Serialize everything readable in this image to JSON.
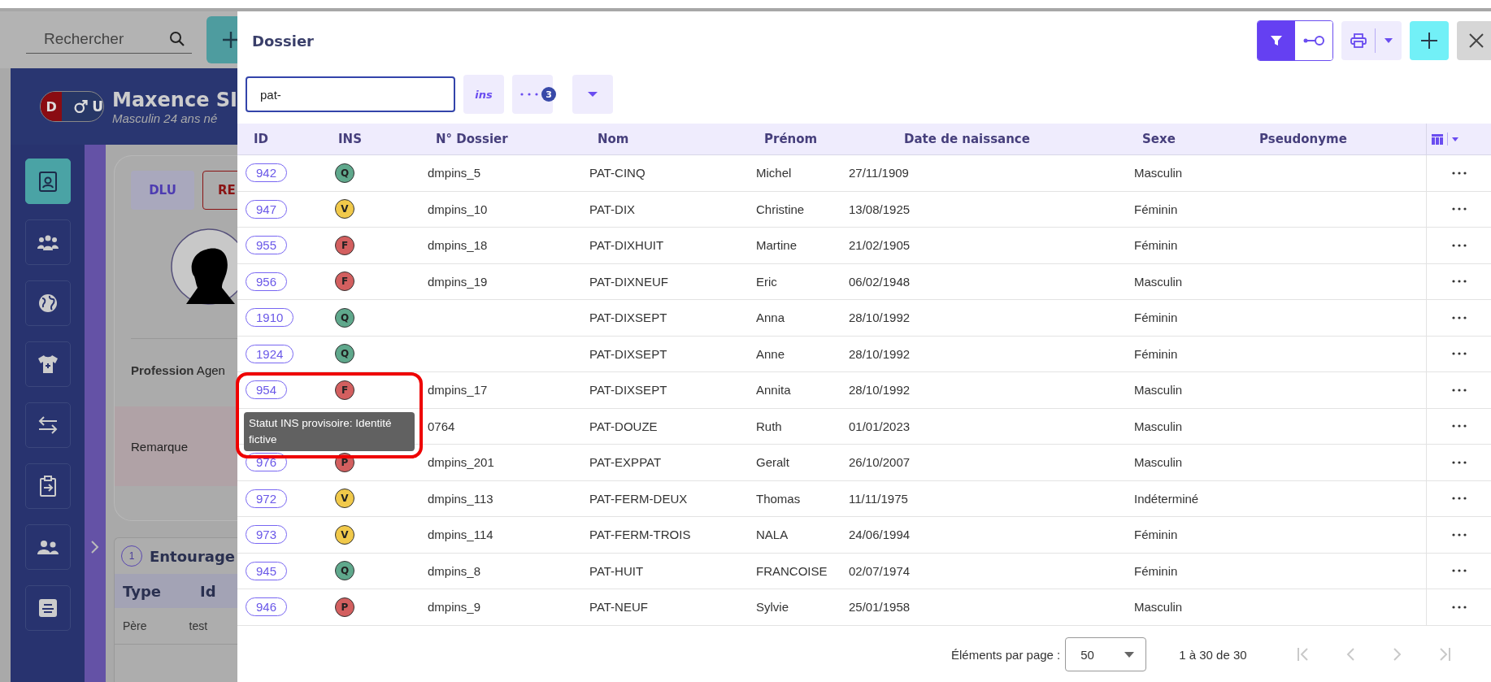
{
  "background": {
    "search_placeholder": "Rechercher",
    "patient": {
      "badge_left": "D",
      "badge_right": "U",
      "name": "Maxence SI",
      "info": "Masculin 24 ans né"
    },
    "nav": [
      {
        "kind": "id-card",
        "selected": true
      },
      {
        "kind": "group",
        "selected": false
      },
      {
        "kind": "globe",
        "selected": false
      },
      {
        "kind": "shirt",
        "selected": false
      },
      {
        "kind": "swap",
        "selected": false
      },
      {
        "kind": "clipboard",
        "selected": false
      },
      {
        "kind": "users",
        "selected": false
      },
      {
        "kind": "note",
        "selected": false
      }
    ],
    "buttons": [
      "DLU",
      "RE"
    ],
    "profession_label": "Profession",
    "profession_value": "Agen",
    "remark_label": "Remarque",
    "section": {
      "count": "1",
      "title": "Entourage",
      "columns": [
        "Type",
        "Id"
      ],
      "row": [
        "Père",
        "test"
      ]
    }
  },
  "dialog": {
    "title": "Dossier",
    "toggle": [
      {
        "kind": "filter",
        "selected": true
      },
      {
        "kind": "link",
        "selected": false
      }
    ],
    "search": {
      "value": "pat-"
    },
    "ins_button": "ins",
    "more_badge": "3",
    "columns": [
      "ID",
      "INS",
      "N° Dossier",
      "Nom",
      "Prénom",
      "Date de naissance",
      "Sexe",
      "Pseudonyme"
    ],
    "rows": [
      {
        "id": "942",
        "ins": "Q",
        "color": "#5fa88c",
        "dossier": "dmpins_5",
        "nom": "PAT-CINQ",
        "prenom": "Michel",
        "naissance": "27/11/1909",
        "sexe": "Masculin"
      },
      {
        "id": "947",
        "ins": "V",
        "color": "#f1c94a",
        "dossier": "dmpins_10",
        "nom": "PAT-DIX",
        "prenom": "Christine",
        "naissance": "13/08/1925",
        "sexe": "Féminin"
      },
      {
        "id": "955",
        "ins": "F",
        "color": "#d35f5f",
        "dossier": "dmpins_18",
        "nom": "PAT-DIXHUIT",
        "prenom": "Martine",
        "naissance": "21/02/1905",
        "sexe": "Féminin"
      },
      {
        "id": "956",
        "ins": "F",
        "color": "#d35f5f",
        "dossier": "dmpins_19",
        "nom": "PAT-DIXNEUF",
        "prenom": "Eric",
        "naissance": "06/02/1948",
        "sexe": "Masculin"
      },
      {
        "id": "1910",
        "ins": "Q",
        "color": "#5fa88c",
        "nom": "PAT-DIXSEPT",
        "prenom": "Anna",
        "naissance": "28/10/1992",
        "sexe": "Féminin"
      },
      {
        "id": "1924",
        "ins": "Q",
        "color": "#5fa88c",
        "nom": "PAT-DIXSEPT",
        "prenom": "Anne",
        "naissance": "28/10/1992",
        "sexe": "Féminin"
      },
      {
        "id": "954",
        "ins": "F",
        "color": "#d35f5f",
        "dossier": "dmpins_17",
        "nom": "PAT-DIXSEPT",
        "prenom": "Annita",
        "naissance": "28/10/1992",
        "sexe": "Masculin",
        "tooltip": "Statut INS provisoire: Identité fictive",
        "highlighted": true
      },
      {
        "dossier": "0764",
        "nom": "PAT-DOUZE",
        "prenom": "Ruth",
        "naissance": "01/01/2023",
        "sexe": "Masculin"
      },
      {
        "id": "976",
        "ins": "P",
        "color": "#d35f5f",
        "dossier": "dmpins_201",
        "nom": "PAT-EXPPAT",
        "prenom": "Geralt",
        "naissance": "26/10/2007",
        "sexe": "Masculin"
      },
      {
        "id": "972",
        "ins": "V",
        "color": "#f1c94a",
        "dossier": "dmpins_113",
        "nom": "PAT-FERM-DEUX",
        "prenom": "Thomas",
        "naissance": "11/11/1975",
        "sexe": "Indéterminé"
      },
      {
        "id": "973",
        "ins": "V",
        "color": "#f1c94a",
        "dossier": "dmpins_114",
        "nom": "PAT-FERM-TROIS",
        "prenom": "NALA",
        "naissance": "24/06/1994",
        "sexe": "Féminin"
      },
      {
        "id": "945",
        "ins": "Q",
        "color": "#5fa88c",
        "dossier": "dmpins_8",
        "nom": "PAT-HUIT",
        "prenom": "FRANCOISE",
        "naissance": "02/07/1974",
        "sexe": "Féminin"
      },
      {
        "id": "946",
        "ins": "P",
        "color": "#d35f5f",
        "dossier": "dmpins_9",
        "nom": "PAT-NEUF",
        "prenom": "Sylvie",
        "naissance": "25/01/1958",
        "sexe": "Masculin"
      }
    ],
    "pagination": {
      "label": "Éléments par page :",
      "page_size": "50",
      "range": "1 à 30 de 30",
      "buttons": [
        {
          "kind": "first",
          "disabled": true
        },
        {
          "kind": "prev",
          "disabled": true
        },
        {
          "kind": "next",
          "disabled": true
        },
        {
          "kind": "last",
          "disabled": true
        }
      ]
    }
  }
}
